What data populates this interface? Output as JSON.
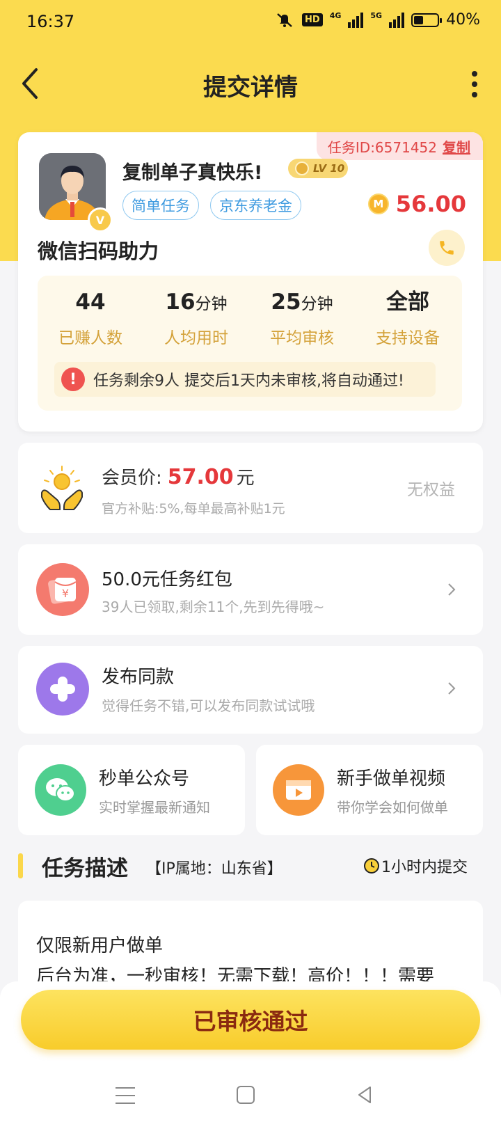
{
  "status": {
    "time": "16:37",
    "battery": "40%",
    "battery_level": 0.4,
    "hd": "HD",
    "net1": "4G",
    "net2": "5G"
  },
  "header": {
    "title": "提交详情"
  },
  "task": {
    "id_label": "任务ID:6571452",
    "copy": "复制",
    "username": "复制单子真快乐!",
    "level": "LV 10",
    "vip_badge": "V",
    "tags": [
      "简单任务",
      "京东养老金"
    ],
    "coin_symbol": "M",
    "reward": "56.00",
    "title": "微信扫码助力",
    "stats": [
      {
        "num": "44",
        "unit": "",
        "label": "已赚人数"
      },
      {
        "num": "16",
        "unit": "分钟",
        "label": "人均用时"
      },
      {
        "num": "25",
        "unit": "分钟",
        "label": "平均审核"
      },
      {
        "num": "全部",
        "unit": "",
        "label": "支持设备"
      }
    ],
    "notice": "任务剩余9人  提交后1天内未审核,将自动通过!"
  },
  "member": {
    "label": "会员价:",
    "price": "57.00",
    "unit": "元",
    "sub": "官方补贴:5%,每单最高补贴1元",
    "right": "无权益"
  },
  "redpack": {
    "title": "50.0元任务红包",
    "sub": "39人已领取,剩余11个,先到先得哦~"
  },
  "publish": {
    "title": "发布同款",
    "sub": "觉得任务不错,可以发布同款试试哦"
  },
  "wechat": {
    "title": "秒单公众号",
    "sub": "实时掌握最新通知"
  },
  "video": {
    "title": "新手做单视频",
    "sub": "带你学会如何做单"
  },
  "section": {
    "title": "任务描述",
    "ip": "【IP属地：山东省】",
    "time": "1小时内提交"
  },
  "description": {
    "line1": "仅限新用户做单",
    "line2": "后台为准，一秒审核！无需下载！高价！！！需要"
  },
  "cta": {
    "label": "已审核通过"
  },
  "colors": {
    "theme_yellow": "#fbdb4f",
    "price_red": "#e5383b"
  }
}
